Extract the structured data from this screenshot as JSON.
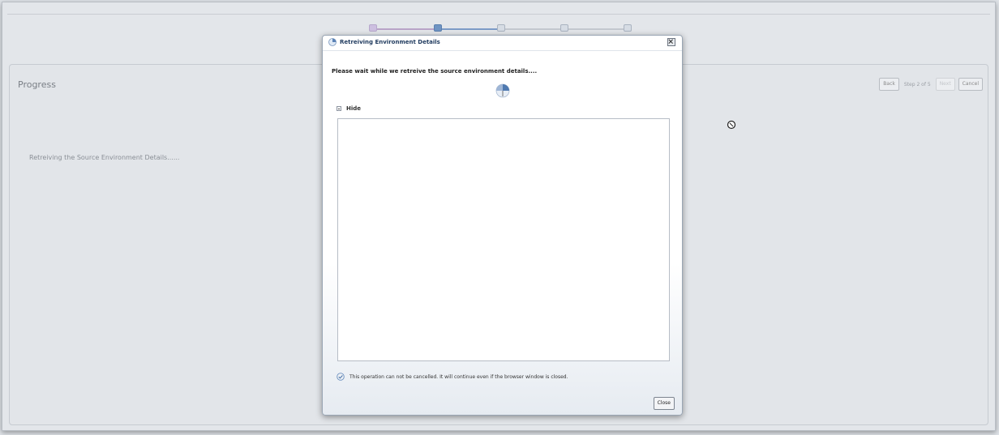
{
  "train": {
    "colors": {
      "visited_line": "#b9a4c8",
      "current_line": "#7d9cc7",
      "pending_line": "#c3c8cf",
      "visited_node": "#cdbfe0",
      "current_node": "#6f94c3",
      "pending_node": "#d0d8e4"
    }
  },
  "progress": {
    "title": "Progress",
    "message": "Retreiving the Source Environment Details......"
  },
  "nav": {
    "back": "Back",
    "step": "Step 2 of 5",
    "next": "Next",
    "cancel": "Cancel"
  },
  "dialog": {
    "title": "Retreiving Environment Details",
    "wait_text": "Please wait while we retreive the source environment details....",
    "hide_label": "Hide",
    "info_text": "This operation can not be cancelled.  It will continue even if the browser window is closed.",
    "close_label": "Close"
  },
  "icons": {
    "dialog": "loading-icon",
    "close": "close-icon",
    "spinner": "spinner-icon",
    "info": "info-check-icon",
    "cursor": "busy-cursor-icon"
  }
}
